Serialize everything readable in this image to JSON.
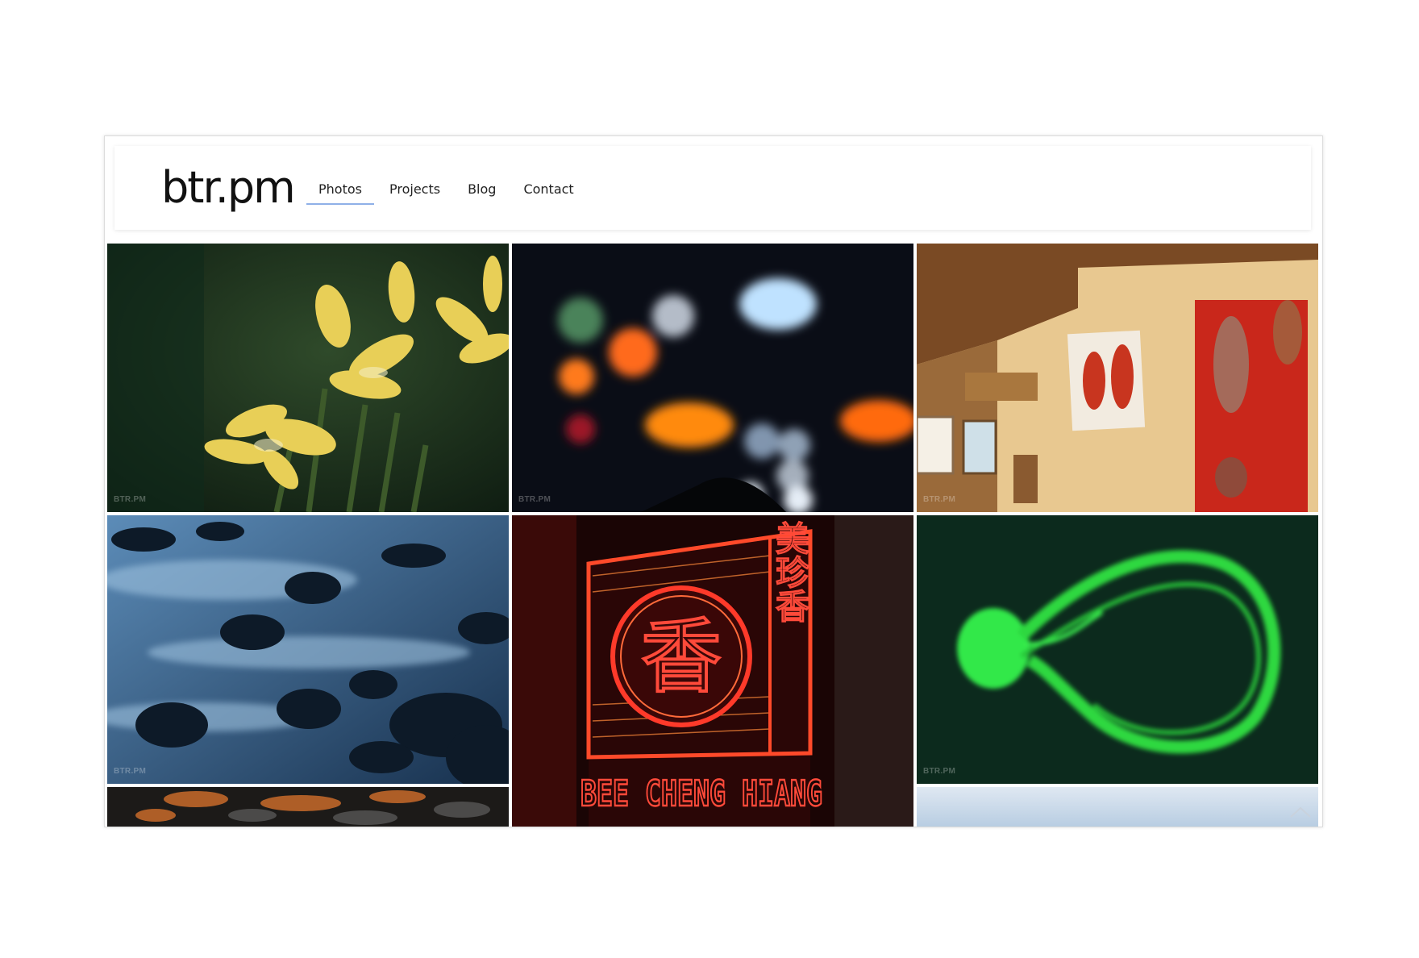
{
  "site": {
    "logo": "btr.pm",
    "nav": [
      {
        "label": "Photos",
        "active": true
      },
      {
        "label": "Projects",
        "active": false
      },
      {
        "label": "Blog",
        "active": false
      },
      {
        "label": "Contact",
        "active": false
      }
    ],
    "active_color": "#8fb0e8"
  },
  "gallery": {
    "watermark": "BTR.PM",
    "photos": [
      {
        "subject": "yellow frangipani flowers with dew"
      },
      {
        "subject": "bokeh city lights through rainy window"
      },
      {
        "subject": "paintings on gallery wall"
      },
      {
        "subject": "long-exposure river rocks"
      },
      {
        "subject": "red neon sign",
        "sign_char": "香",
        "sign_side_text": "美珍香",
        "sign_bottom_text": "BEE CHENG HIANG"
      },
      {
        "subject": "glowing green jellyfish"
      },
      {
        "subject": "orange-lit stones"
      },
      {
        "subject": "pale blue sky"
      }
    ]
  },
  "icons": {
    "scroll_top": "chevron-up-icon"
  }
}
